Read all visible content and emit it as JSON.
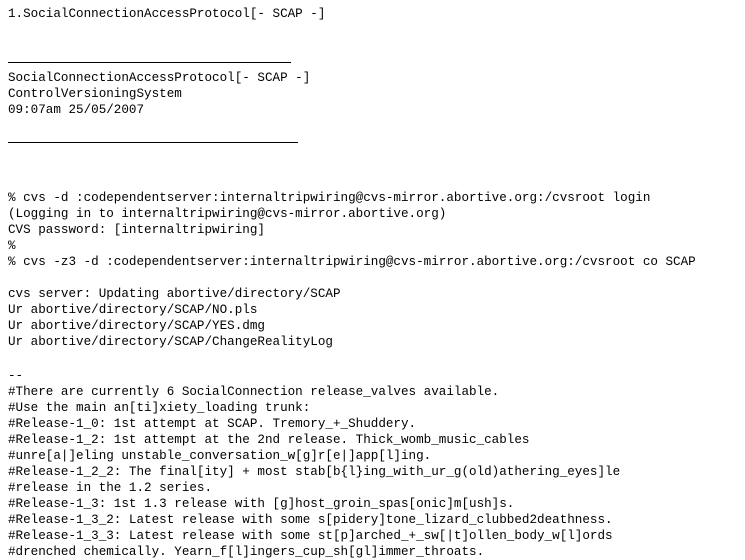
{
  "document": {
    "title_line": "1.SocialConnectionAccessProtocol[- SCAP -]",
    "header": {
      "name": "SocialConnectionAccessProtocol[- SCAP -]",
      "system": "ControlVersioningSystem",
      "timestamp": "09:07am 25/05/2007"
    },
    "rules": {
      "top_label": "header-rule-top",
      "bottom_label": "header-rule-bottom"
    },
    "terminal": {
      "login_command": "% cvs -d :codependentserver:internaltripwiring@cvs-mirror.abortive.org:/cvsroot login",
      "login_notice": "(Logging in to internaltripwiring@cvs-mirror.abortive.org)",
      "password_prompt": "CVS password: [internaltripwiring]",
      "bare_prompt": "%",
      "checkout_command": "% cvs -z3 -d :codependentserver:internaltripwiring@cvs-mirror.abortive.org:/cvsroot co SCAP"
    },
    "checkout_output": {
      "updating": "cvs server: Updating abortive/directory/SCAP",
      "files": [
        "Ur abortive/directory/SCAP/NO.pls",
        "Ur abortive/directory/SCAP/YES.dmg",
        "Ur abortive/directory/SCAP/ChangeRealityLog"
      ]
    },
    "notes": {
      "separator": "--",
      "lines": [
        "#There are currently 6 SocialConnection release_valves available.",
        "#Use the main an[ti]xiety_loading trunk:",
        "#Release-1_0: 1st attempt at SCAP. Tremory_+_Shuddery.",
        "#Release-1_2: 1st attempt at the 2nd release. Thick_womb_music_cables",
        "#unre[a|]eling unstable_conversation_w[g]r[e|]app[l]ing.",
        "#Release-1_2_2: The final[ity] + most stab[b{l}ing_with_ur_g(old)athering_eyes]le",
        "#release in the 1.2 series.",
        "#Release-1_3: 1st 1.3 release with [g]host_groin_spas[onic]m[ush]s.",
        "#Release-1_3_2: Latest release with some s[pidery]tone_lizard_clubbed2deathness.",
        "#Release-1_3_3: Latest release with some st[p]arched_+_sw[|t]ollen_body_w[l]ords",
        "#drenched chemically. Yearn_f[l]ingers_cup_sh[gl]immer_throats."
      ]
    }
  },
  "colors": {
    "text": "#000000",
    "background": "#ffffff"
  }
}
